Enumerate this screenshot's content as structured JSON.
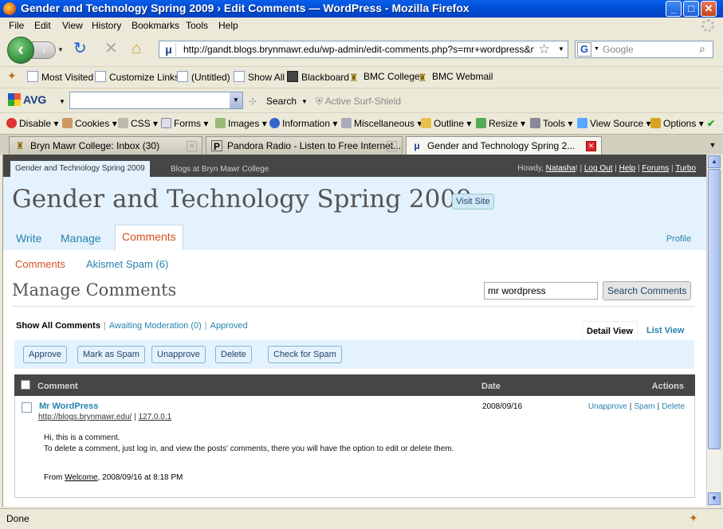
{
  "window": {
    "title": "Gender and Technology Spring 2009 › Edit Comments — WordPress - Mozilla Firefox",
    "minimize": "_",
    "maximize": "□",
    "close": "✕"
  },
  "menubar": [
    "File",
    "Edit",
    "View",
    "History",
    "Bookmarks",
    "Tools",
    "Help"
  ],
  "navbar": {
    "url": "http://gandt.blogs.brynmawr.edu/wp-admin/edit-comments.php?s=mr+wordpress&mode=",
    "search_engine": "G",
    "search_placeholder": "Google"
  },
  "bookmarks": [
    "Most Visited",
    "Customize Links",
    "(Untitled)",
    "Show All",
    "Blackboard",
    "BMC College",
    "BMC Webmail"
  ],
  "avg_toolbar": {
    "logo": "AVG",
    "search_label": "Search",
    "surf_shield": "Active Surf-Shield"
  },
  "webdev_toolbar": [
    "Disable",
    "Cookies",
    "CSS",
    "Forms",
    "Images",
    "Information",
    "Miscellaneous",
    "Outline",
    "Resize",
    "Tools",
    "View Source",
    "Options"
  ],
  "tabs": [
    {
      "label": "Bryn Mawr College: Inbox (30)",
      "active": false
    },
    {
      "label": "Pandora Radio - Listen to Free Internet...",
      "active": false
    },
    {
      "label": "Gender and Technology Spring 2...",
      "active": true
    }
  ],
  "wp": {
    "blog_tab": "Gender and Technology Spring 2009",
    "blogs_link": "Blogs at Bryn Mawr College",
    "howdy": "Howdy,",
    "username": "Natasha",
    "excl": "!",
    "user_links": [
      "Log Out",
      "Help",
      "Forums",
      "Turbo"
    ],
    "blog_title": "Gender and Technology Spring 2009",
    "visit_site": "Visit Site",
    "main_nav": [
      "Write",
      "Manage",
      "Comments"
    ],
    "profile": "Profile",
    "sub_nav": [
      "Comments",
      "Akismet Spam (6)"
    ],
    "page_title": "Manage Comments",
    "search_value": "mr wordpress",
    "search_button": "Search Comments",
    "filters": {
      "current": "Show All Comments",
      "awaiting": "Awaiting Moderation (0)",
      "approved": "Approved"
    },
    "views": {
      "detail": "Detail View",
      "list": "List View"
    },
    "bulk_buttons": [
      "Approve",
      "Mark as Spam",
      "Unapprove",
      "Delete"
    ],
    "check_spam": "Check for Spam",
    "columns": {
      "comment": "Comment",
      "date": "Date",
      "actions": "Actions"
    },
    "comment": {
      "author": "Mr WordPress",
      "url": "http://blogs.brynmawr.edu/",
      "ip": "127.0.0.1",
      "body_1": "Hi, this is a comment.",
      "body_2": "To delete a comment, just log in, and view the posts' comments, there you will have the option to edit or delete them.",
      "from_prefix": "From",
      "from_post": "Welcome",
      "from_suffix": ", 2008/09/16 at 8:18 PM",
      "date": "2008/09/16",
      "actions": [
        "Unapprove",
        "Spam",
        "Delete"
      ]
    }
  },
  "status": "Done"
}
